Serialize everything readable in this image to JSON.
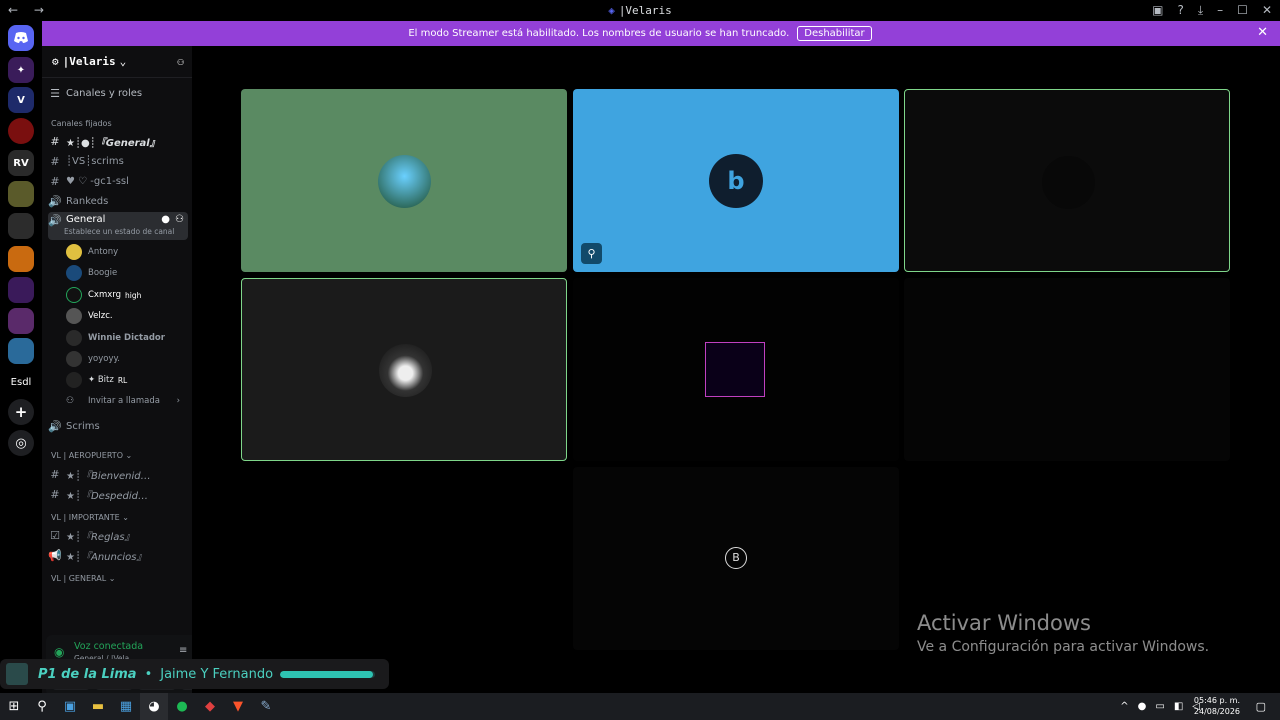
{
  "window": {
    "title": "|Velaris",
    "nav_arrows": "← →",
    "controls": [
      "▣",
      "?",
      "⤓",
      "–",
      "☐",
      "✕"
    ]
  },
  "banner": {
    "message": "El modo Streamer está habilitado. Los nombres de usuario se han truncado.",
    "button": "Deshabilitar",
    "close": "✕"
  },
  "guilds": [
    {
      "label": "",
      "color": "#5865f2",
      "icon": "discord-icon"
    },
    {
      "label": "",
      "color": "#3a1c5a",
      "icon": "server-1"
    },
    {
      "label": "",
      "color": "#1e2a6a",
      "icon": "server-velaris"
    },
    {
      "label": "",
      "color": "#6a0f0f",
      "icon": "server-3"
    },
    {
      "label": "",
      "color": "#2a2a2a",
      "icon": "server-rv"
    },
    {
      "label": "",
      "color": "#5a5a2a",
      "icon": "server-5"
    },
    {
      "label": "",
      "color": "#222",
      "icon": "server-6"
    },
    {
      "label": "",
      "color": "#c96a10",
      "icon": "server-7"
    },
    {
      "label": "",
      "color": "#3a1a5a",
      "icon": "server-8"
    },
    {
      "label": "",
      "color": "#5a2a6a",
      "icon": "server-9"
    },
    {
      "label": "",
      "color": "#2a6a9a",
      "icon": "server-10"
    },
    {
      "label": "Esdl",
      "color": "#000",
      "icon": "esdl"
    },
    {
      "label": "+",
      "color": "#1e1f22",
      "icon": "add-server-icon"
    },
    {
      "label": "◎",
      "color": "#1e1f22",
      "icon": "discover-icon"
    }
  ],
  "server": {
    "name": "|Velaris",
    "chevron": "⌄",
    "channels_roles": "Canales y roles",
    "pinned_header": "Canales fijados",
    "channels": [
      {
        "icon": "#",
        "name": "★┊●┊『General』"
      },
      {
        "icon": "#",
        "name": "┊VS┊scrims"
      },
      {
        "icon": "#",
        "name": "♥ ♡ -gc1-ssl"
      },
      {
        "icon": "🔊",
        "name": "Rankeds"
      },
      {
        "icon": "🔊",
        "name": "General",
        "status": "Establece un estado de canal"
      }
    ],
    "voice_users": [
      {
        "name": "Antony",
        "color": "#e0c040"
      },
      {
        "name": "Boogie",
        "color": "#1a4a7a"
      },
      {
        "name": "Cxmxrg",
        "badge": "high",
        "color": "#111"
      },
      {
        "name": "Velzc.",
        "color": "#555"
      },
      {
        "name": "Winnie Dictador",
        "color": "#2a2a2a"
      },
      {
        "name": "yoyoyy.",
        "color": "#333"
      },
      {
        "name": "✦ Bitz",
        "badge": "RL",
        "color": "#222"
      }
    ],
    "invite": "Invitar a llamada",
    "scrims": "Scrims",
    "cat_aeropuerto": "VL | AEROPUERTO ⌄",
    "aero_channels": [
      "★┊『Bienvenid…",
      "★┊『Despedid…"
    ],
    "cat_importante": "VL | IMPORTANTE ⌄",
    "imp_channels": [
      "★┊『Reglas』",
      "★┊『Anuncios』"
    ],
    "cat_general": "VL | GENERAL ⌄"
  },
  "voice": {
    "status": "Voz conectada",
    "location": "General / |Vela..."
  },
  "now_playing": {
    "song": "P1 de la Lima",
    "artist": "Jaime Y Fernando",
    "progress": 0.98
  },
  "watermark": {
    "title": "Activar Windows",
    "subtitle": "Ve a Configuración para activar Windows."
  },
  "taskbar": {
    "time": "05:46 p. m.",
    "date": "24/08/2026"
  },
  "colors": {
    "accent": "#9340d8",
    "tile_green": "#5a8a62",
    "tile_blue": "#3fa4e0",
    "speaking_border": "#7fd68a"
  }
}
